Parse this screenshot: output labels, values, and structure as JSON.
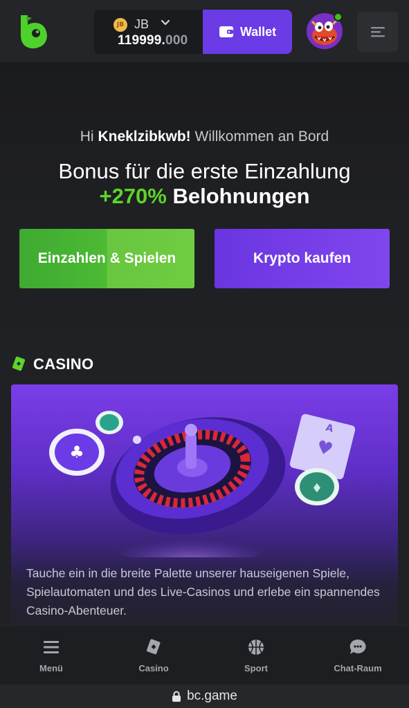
{
  "header": {
    "currency": "JB",
    "coin_symbol": "JB",
    "balance_main": "119999.",
    "balance_decimals": "000",
    "wallet_label": "Wallet"
  },
  "welcome": {
    "greeting_prefix": "Hi",
    "username": "Kneklzibkwb!",
    "greeting_suffix": "Willkommen an Bord",
    "bonus_line1": "Bonus für die erste Einzahlung",
    "bonus_percent": "+270%",
    "bonus_rewards": "Belohnungen",
    "deposit_button": "Einzahlen & Spielen",
    "crypto_button": "Krypto kaufen"
  },
  "casino": {
    "title": "CASINO",
    "description": "Tauche ein in die breite Palette unserer hauseigenen Spiele, Spielautomaten und des Live-Casinos und erlebe ein spannendes Casino-Abenteuer."
  },
  "bottom_nav": [
    {
      "label": "Menü",
      "icon": "menu-icon"
    },
    {
      "label": "Casino",
      "icon": "casino-icon"
    },
    {
      "label": "Sport",
      "icon": "basketball-icon"
    },
    {
      "label": "Chat-Raum",
      "icon": "chat-icon"
    }
  ],
  "url_bar": {
    "url": "bc.game"
  },
  "colors": {
    "accent_purple": "#6b3be6",
    "accent_green": "#5dd42a",
    "background": "#1b1c1f"
  }
}
